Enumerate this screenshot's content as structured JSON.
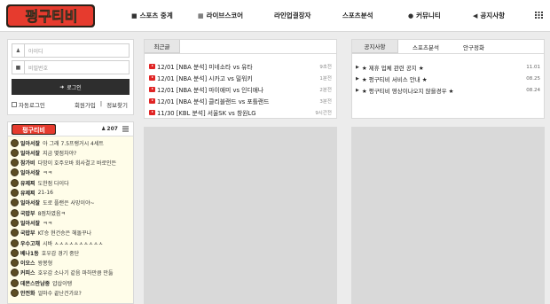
{
  "header": {
    "logo_text": "펑구티비",
    "nav": [
      {
        "icon": "video-icon",
        "glyph": "■",
        "label": "스포츠 중계"
      },
      {
        "icon": "grid-icon",
        "glyph": "▦",
        "label": "라이브스코어"
      },
      {
        "icon": "",
        "glyph": "",
        "label": "라인업결장자"
      },
      {
        "icon": "",
        "glyph": "",
        "label": "스포츠분석"
      },
      {
        "icon": "chat-icon",
        "glyph": "●",
        "label": "커뮤니티"
      },
      {
        "icon": "megaphone-icon",
        "glyph": "◀",
        "label": "공지사항"
      }
    ]
  },
  "login": {
    "id_placeholder": "아이디",
    "pw_placeholder": "비밀번호",
    "button_label": "로그인",
    "autologin_label": "자동로그인",
    "signup_label": "회원가입",
    "find_label": "정보찾기"
  },
  "chat": {
    "user_count": "207",
    "messages": [
      {
        "nick": "일아서잘",
        "text": "아 그래 7.5프랭거시 4세트"
      },
      {
        "nick": "일아서잘",
        "text": "지금 몇점차야?"
      },
      {
        "nick": "참가비",
        "text": "다밤이 호주오바 회사결고 바로인든"
      },
      {
        "nick": "일아서잘",
        "text": "ㅋㅋ"
      },
      {
        "nick": "유제찌",
        "text": "도한점 다이다"
      },
      {
        "nick": "유제찌",
        "text": "21-16"
      },
      {
        "nick": "일아서잘",
        "text": "도로 플랜은 사망이야~"
      },
      {
        "nick": "국밥부",
        "text": "8점차였음ㅋ"
      },
      {
        "nick": "일아서잘",
        "text": "ㅋㅋ"
      },
      {
        "nick": "국밥부",
        "text": "KT승 현건승은 헤돌꾸나"
      },
      {
        "nick": "우수고채",
        "text": "시바 ㅅㅅㅅㅅㅅㅅㅅㅅㅅㅅ"
      },
      {
        "nick": "베나1등",
        "text": "호우감 경기 중단"
      },
      {
        "nick": "이오스",
        "text": "왕봉형"
      },
      {
        "nick": "커피스",
        "text": "호우감 소나기 같음 마하만큼 만듦"
      },
      {
        "nick": "데몬스만남중",
        "text": "얍삽이탱"
      },
      {
        "nick": "안전화",
        "text": "얼마수 끝난건가요?"
      }
    ]
  },
  "recent": {
    "tab_label": "최근글",
    "posts": [
      {
        "title": "12/01 [NBA 분석] 미네소타 vs 유타",
        "time": "9초전"
      },
      {
        "title": "12/01 [NBA 분석] 시카고 vs 밀워키",
        "time": "1분전"
      },
      {
        "title": "12/01 [NBA 분석] 마이애미 vs 인디애나",
        "time": "2분전"
      },
      {
        "title": "12/01 [NBA 분석] 클리블랜드 vs 포틀랜드",
        "time": "3분전"
      },
      {
        "title": "11/30 [KBL 분석] 서울SK vs 창원LG",
        "time": "9시간전"
      }
    ]
  },
  "notice": {
    "tabs": [
      "공지사항",
      "스포츠분석",
      "안구정화"
    ],
    "items": [
      {
        "title": "★ 제휴 업체 관련 공지 ★",
        "date": "11.01"
      },
      {
        "title": "★ 펑구티비 서비스 안내 ★",
        "date": "08.25"
      },
      {
        "title": "★ 펑구티비 영상이나오지 않을경우 ★",
        "date": "08.24"
      }
    ]
  },
  "colors": {
    "logo_red": "#e63b2e",
    "logo_outline": "#3a2a1a",
    "youtube_red": "#e02424",
    "chat_bg": "#fffde9"
  }
}
